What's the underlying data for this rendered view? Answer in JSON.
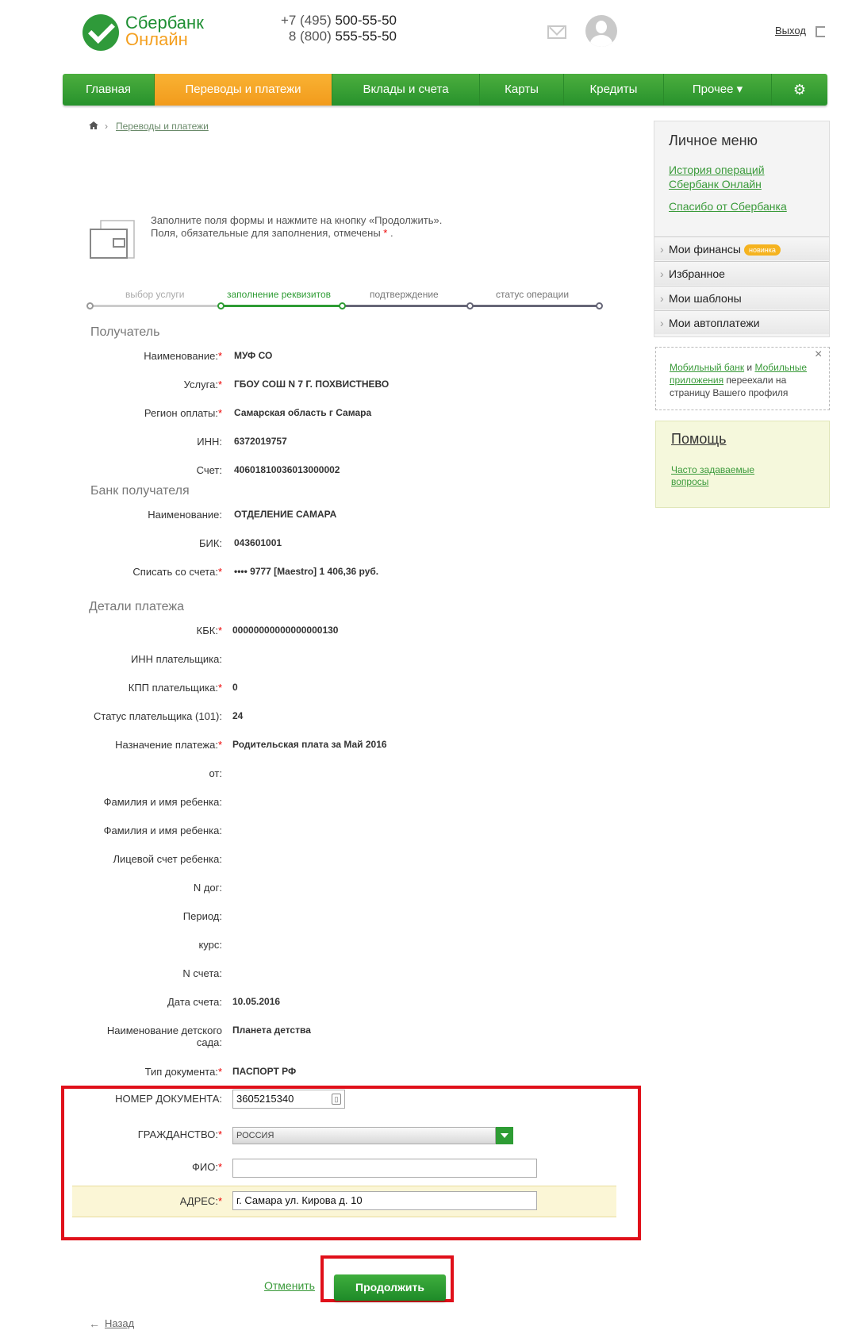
{
  "header": {
    "brand_line1": "Сбербанк",
    "brand_line2": "Онлайн",
    "phone1_prefix": "+7 (495)",
    "phone1": "500-55-50",
    "phone2_prefix": "8 (800)",
    "phone2": "555-55-50",
    "logout": "Выход"
  },
  "nav": {
    "items": [
      "Главная",
      "Переводы и платежи",
      "Вклады и счета",
      "Карты",
      "Кредиты",
      "Прочее ▾"
    ],
    "active": "Переводы и платежи"
  },
  "breadcrumb": {
    "current": "Переводы и платежи"
  },
  "info": {
    "line1": "Заполните поля формы и нажмите на кнопку «Продолжить».",
    "line2": "Поля, обязательные для заполнения, отмечены",
    "star": "*",
    "dot": "."
  },
  "progress": {
    "steps": [
      "выбор услуги",
      "заполнение реквизитов",
      "подтверждение",
      "статус операции"
    ],
    "active_step": 1
  },
  "recipient": {
    "title": "Получатель",
    "rows": [
      {
        "label": "Наименование:",
        "required": true,
        "value": "МУФ СО"
      },
      {
        "label": "Услуга:",
        "required": true,
        "value": "ГБОУ СОШ N 7 Г. ПОХВИСТНЕВО"
      },
      {
        "label": "Регион оплаты:",
        "required": true,
        "value": "Самарская область г Самара"
      },
      {
        "label": "ИНН:",
        "required": false,
        "value": "6372019757"
      },
      {
        "label": "Счет:",
        "required": false,
        "value": "40601810036013000002"
      }
    ]
  },
  "bank": {
    "title": "Банк получателя",
    "rows": [
      {
        "label": "Наименование:",
        "required": false,
        "value": "ОТДЕЛЕНИЕ САМАРА"
      },
      {
        "label": "БИК:",
        "required": false,
        "value": "043601001"
      },
      {
        "label": "Списать со счета:",
        "required": true,
        "value": "•••• 9777  [Maestro] 1 406,36   руб."
      }
    ]
  },
  "details": {
    "title": "Детали платежа",
    "rows": [
      {
        "label": "КБК:",
        "required": true,
        "value": "00000000000000000130"
      },
      {
        "label": "ИНН плательщика:",
        "required": false,
        "value": ""
      },
      {
        "label": "КПП плательщика:",
        "required": true,
        "value": "0"
      },
      {
        "label": "Статус плательщика (101):",
        "required": false,
        "value": "24"
      },
      {
        "label": "Назначение платежа:",
        "required": true,
        "value": "Родительская плата за Май 2016"
      },
      {
        "label": "от:",
        "required": false,
        "value": ""
      },
      {
        "label": "Фамилия и имя ребенка:",
        "required": false,
        "value": ""
      },
      {
        "label": "Фамилия и имя ребенка:",
        "required": false,
        "value": ""
      },
      {
        "label": "Лицевой счет ребенка:",
        "required": false,
        "value": ""
      },
      {
        "label": "N дог:",
        "required": false,
        "value": ""
      },
      {
        "label": "Период:",
        "required": false,
        "value": ""
      },
      {
        "label": "курс:",
        "required": false,
        "value": ""
      },
      {
        "label": "N счета:",
        "required": false,
        "value": ""
      },
      {
        "label": "Дата счета:",
        "required": false,
        "value": "10.05.2016"
      },
      {
        "label_line1": "Наименование детского",
        "label_line2": "сада:",
        "required": false,
        "value": "Планета детства"
      },
      {
        "label": "Тип документа:",
        "required": true,
        "value": "ПАСПОРТ РФ"
      }
    ]
  },
  "inputs": {
    "doc_number_label": "НОМЕР ДОКУМЕНТА:",
    "doc_number_value": "3605215340",
    "citizenship_label": "ГРАЖДАНСТВО:",
    "citizenship_value": "РОССИЯ",
    "fio_label": "ФИО:",
    "fio_value": "",
    "address_label": "АДРЕС:",
    "address_value": "г. Самара ул. Кирова д. 10",
    "required_mark": "*"
  },
  "actions": {
    "cancel": "Отменить",
    "continue": "Продолжить",
    "back": "Назад"
  },
  "sidebar": {
    "title": "Личное меню",
    "links": [
      "История операций Сбербанк Онлайн",
      "Спасибо от Сбербанка"
    ],
    "link1_line1": "История операций",
    "link1_line2": "Сбербанк Онлайн",
    "items": [
      "Мои финансы",
      "Избранное",
      "Мои шаблоны",
      "Мои автоплатежи"
    ],
    "badge": "новинка",
    "notice_link1": "Мобильный банк",
    "notice_and": " и ",
    "notice_link2a": "Мобильные",
    "notice_link2b": "приложения",
    "notice_rest1": " переехали на",
    "notice_rest2": "страницу Вашего профиля",
    "help_title": "Помощь",
    "help_link_line1": "Часто задаваемые",
    "help_link_line2": "вопросы"
  },
  "colors": {
    "green": "#2f9a3a",
    "orange": "#f4a020",
    "highlight_red": "#e0101a"
  }
}
